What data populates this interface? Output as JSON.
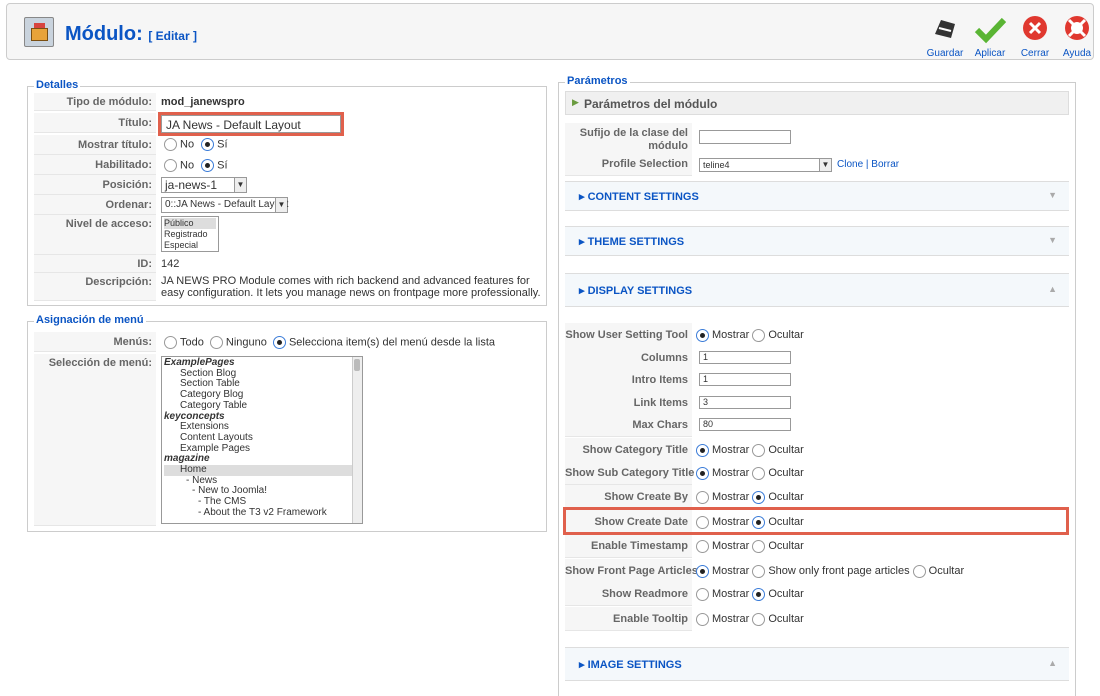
{
  "header": {
    "title": "Módulo:",
    "subtitle": "[ Editar ]"
  },
  "toolbar": {
    "save": "Guardar",
    "apply": "Aplicar",
    "close": "Cerrar",
    "help": "Ayuda"
  },
  "details": {
    "legend": "Detalles",
    "type_label": "Tipo de módulo:",
    "type_value": "mod_janewspro",
    "title_label": "Título:",
    "title_value": "JA News - Default Layout",
    "show_title_label": "Mostrar título:",
    "no": "No",
    "yes": "Sí",
    "enabled_label": "Habilitado:",
    "position_label": "Posición:",
    "position_value": "ja-news-1",
    "order_label": "Ordenar:",
    "order_value": "0::JA News - Default Layout",
    "access_label": "Nivel de acceso:",
    "access_options": [
      "Público",
      "Registrado",
      "Especial"
    ],
    "id_label": "ID:",
    "id_value": "142",
    "desc_label": "Descripción:",
    "desc_value": "JA NEWS PRO Module comes with rich backend and advanced features for easy configuration. It lets you manage news on frontpage more professionally."
  },
  "menu": {
    "legend": "Asignación de menú",
    "menus_label": "Menús:",
    "opt_all": "Todo",
    "opt_none": "Ninguno",
    "opt_select": "Selecciona item(s) del menú desde la lista",
    "selection_label": "Selección de menú:",
    "items": [
      "ExamplePages",
      "Section Blog",
      "Section Table",
      "Category Blog",
      "Category Table",
      "keyconcepts",
      "Extensions",
      "Content Layouts",
      "Example Pages",
      "magazine",
      "Home",
      "- News",
      "- New to Joomla!",
      "- The CMS",
      "- About the T3 v2 Framework"
    ]
  },
  "params": {
    "legend": "Parámetros",
    "module_params": "Parámetros del módulo",
    "suffix_label": "Sufijo de la clase del módulo",
    "profile_label": "Profile Selection",
    "profile_value": "teline4",
    "clone": "Clone",
    "delete": "Borrar",
    "content_settings": "CONTENT SETTINGS",
    "theme_settings": "THEME SETTINGS",
    "display_settings": "DISPLAY SETTINGS",
    "image_settings": "IMAGE SETTINGS",
    "show": "Mostrar",
    "hide": "Ocultar",
    "only_front": "Show only front page articles",
    "rows": [
      {
        "label": "Show User Setting Tool"
      },
      {
        "label": "Columns",
        "value": "1"
      },
      {
        "label": "Intro Items",
        "value": "1"
      },
      {
        "label": "Link Items",
        "value": "3"
      },
      {
        "label": "Max Chars",
        "value": "80"
      },
      {
        "label": "Show Category Title"
      },
      {
        "label": "Show Sub Category Title"
      },
      {
        "label": "Show Create By"
      },
      {
        "label": "Show Create Date"
      },
      {
        "label": "Enable Timestamp"
      },
      {
        "label": "Show Front Page Articles"
      },
      {
        "label": "Show Readmore"
      },
      {
        "label": "Enable Tooltip"
      }
    ]
  }
}
